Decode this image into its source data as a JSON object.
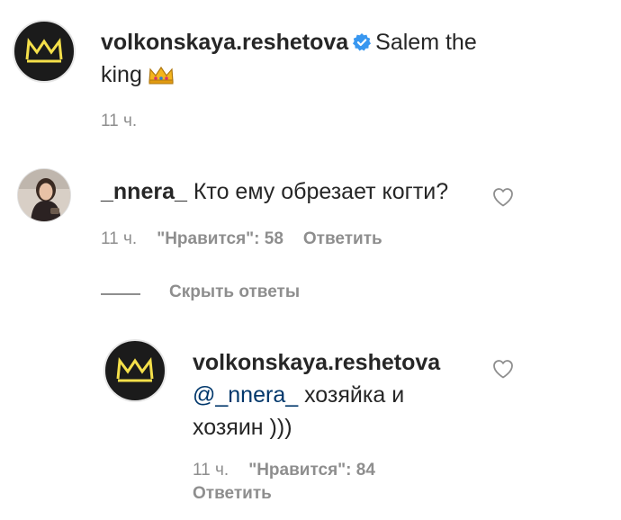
{
  "post_caption": {
    "username": "volkonskaya.reshetova",
    "text_line1": "Salem the",
    "text_line2": "king",
    "time": "11 ч.",
    "emoji": "crown-icon"
  },
  "comment": {
    "username": "_nnera_",
    "text": "Кто ему обрезает когти?",
    "time": "11 ч.",
    "likes": "\"Нравится\": 58",
    "reply_label": "Ответить"
  },
  "hide_replies_label": "Скрыть ответы",
  "reply": {
    "username": "volkonskaya.reshetova",
    "mention": "@_nnera_",
    "text_line1": " хозяйка и",
    "text_line2": "хозяин )))",
    "time": "11 ч.",
    "likes": "\"Нравится\": 84",
    "reply_label": "Ответить"
  },
  "colors": {
    "text": "#262626",
    "meta": "#8e8e8e",
    "mention": "#00376b",
    "verified": "#3897f0",
    "crown_logo": "#f5e04a"
  }
}
